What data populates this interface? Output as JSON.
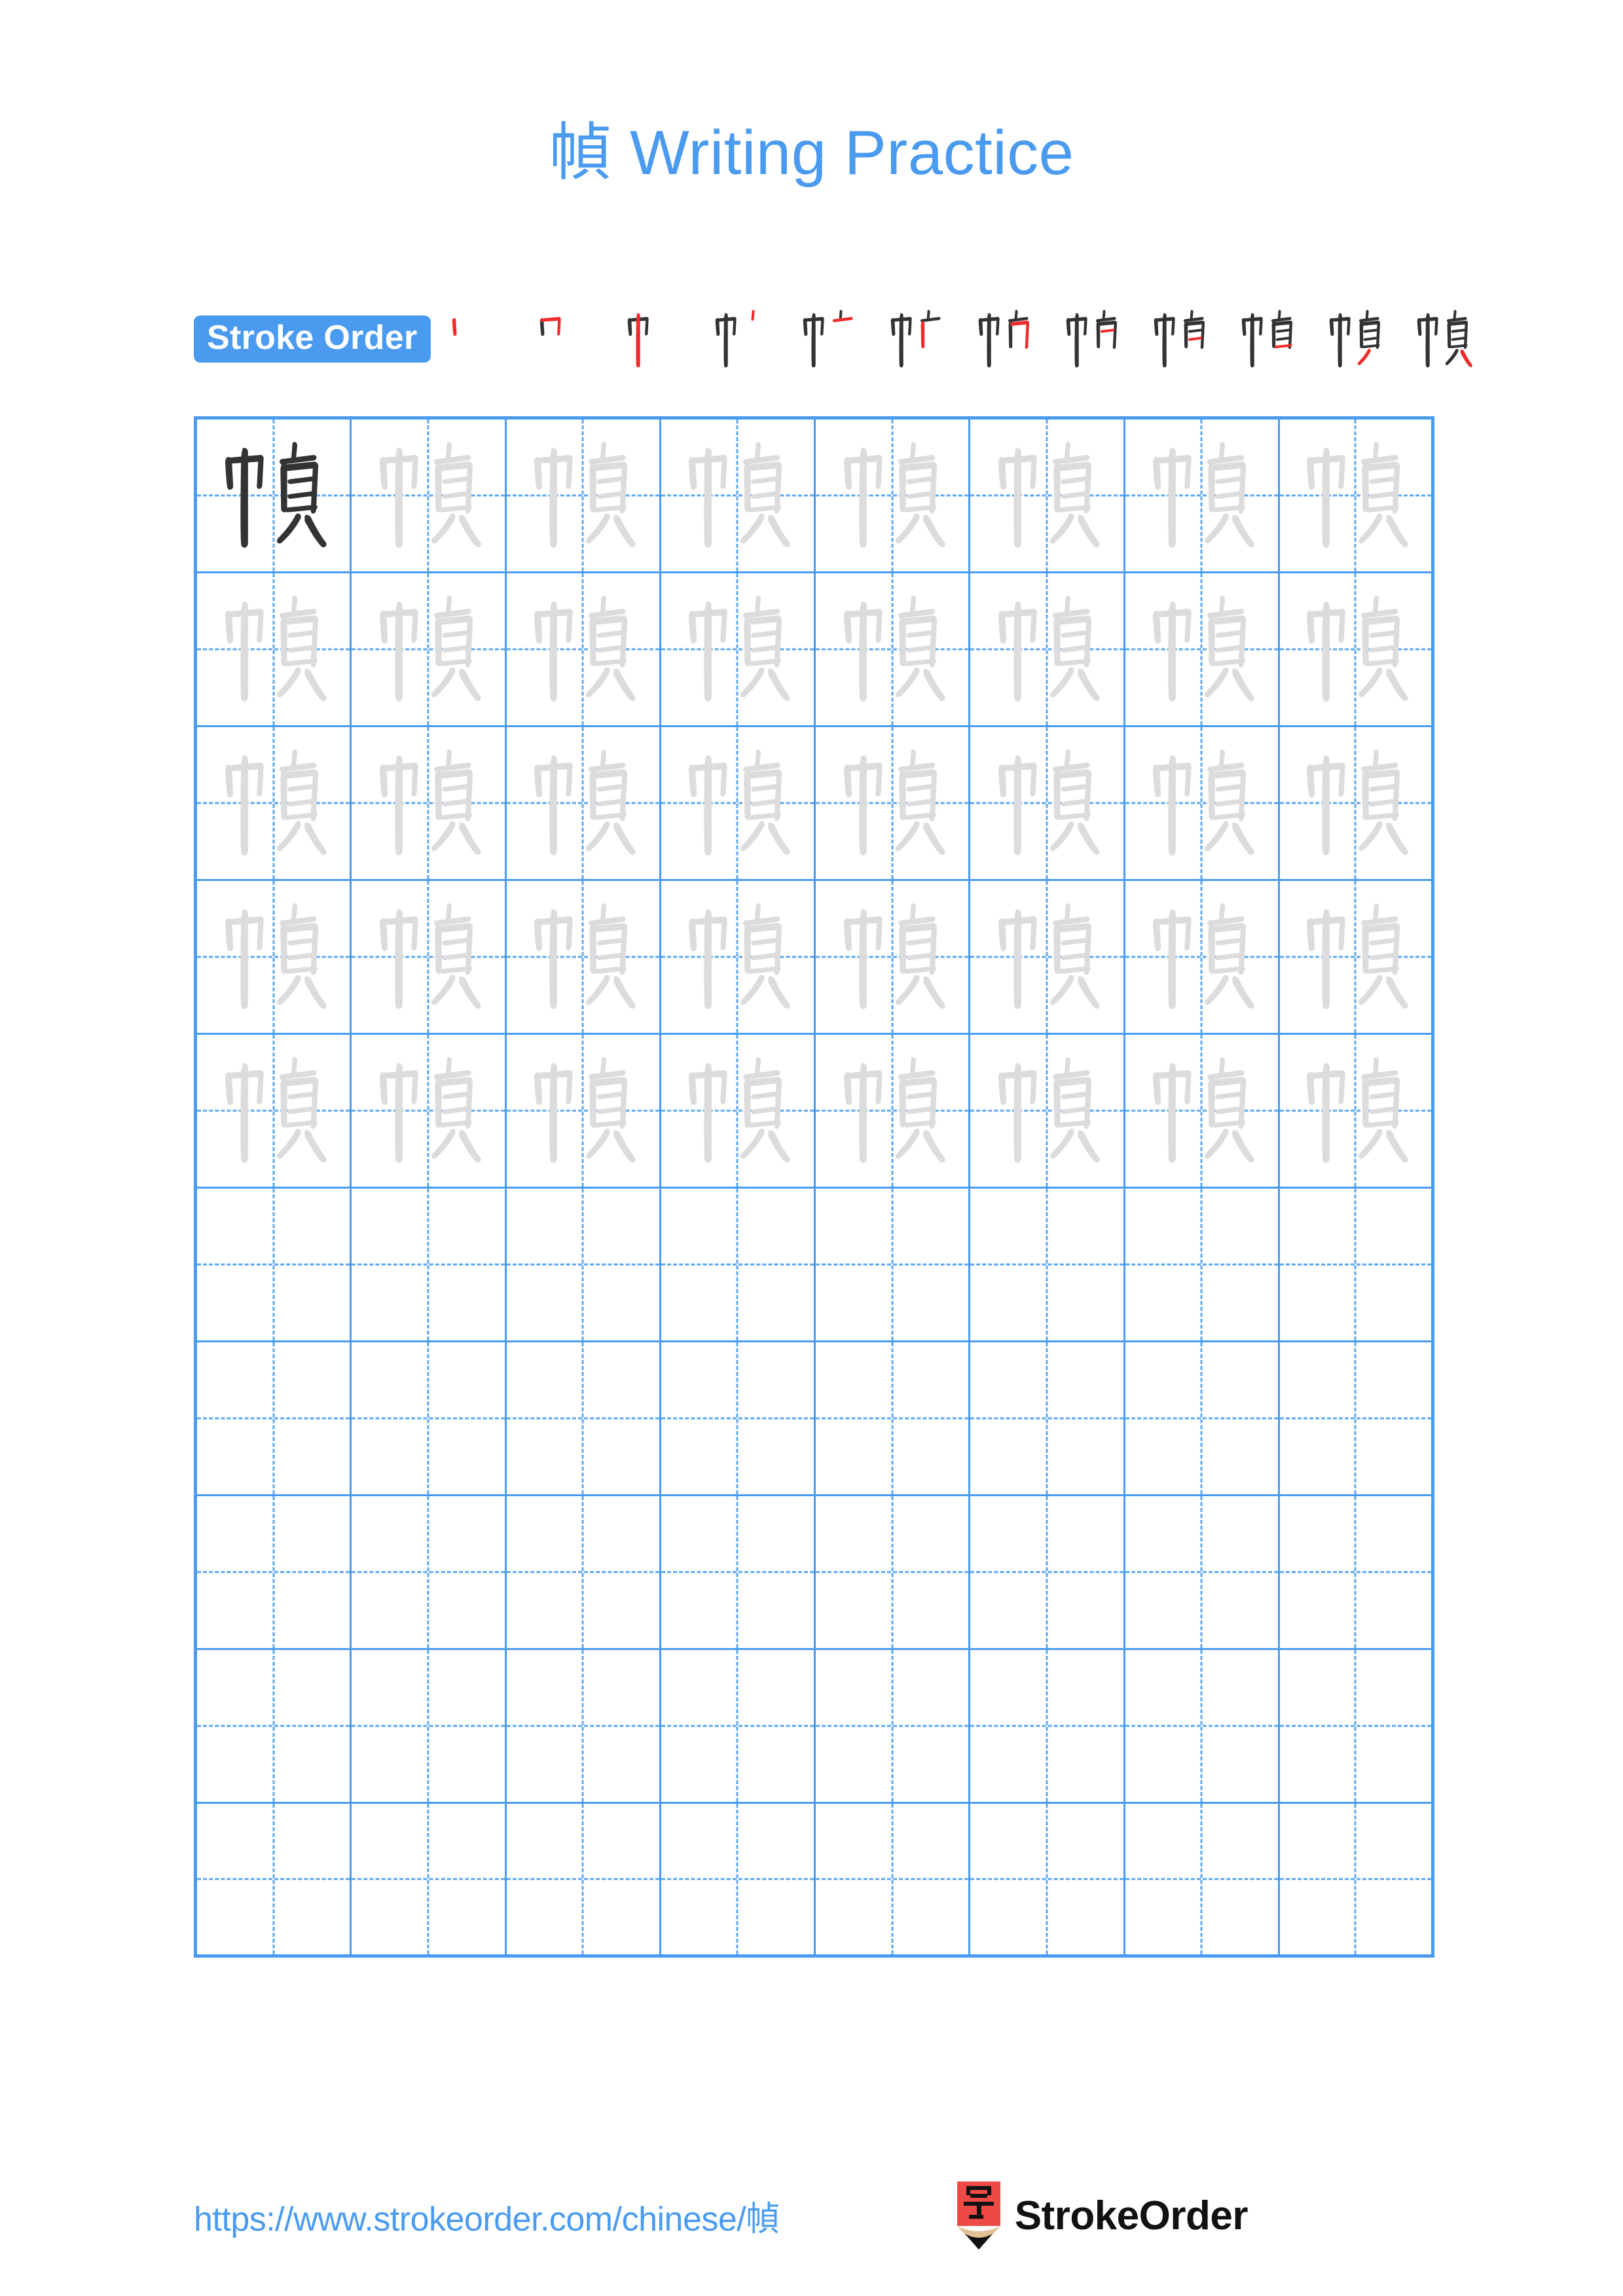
{
  "page": {
    "character": "幀",
    "title": "幀 Writing Practice",
    "title_character": "幀",
    "title_text": " Writing Practice",
    "accent_color": "#4a9bf0",
    "highlight_stroke_color": "#ef2b2b",
    "ink_color": "#333333",
    "trace_color": "#dcdcdc"
  },
  "stroke_order": {
    "label": "Stroke Order",
    "total_strokes": 12,
    "steps": [
      {
        "index": 1,
        "strokes_shown": 1,
        "new_stroke": 1
      },
      {
        "index": 2,
        "strokes_shown": 2,
        "new_stroke": 2
      },
      {
        "index": 3,
        "strokes_shown": 3,
        "new_stroke": 3
      },
      {
        "index": 4,
        "strokes_shown": 4,
        "new_stroke": 4
      },
      {
        "index": 5,
        "strokes_shown": 5,
        "new_stroke": 5
      },
      {
        "index": 6,
        "strokes_shown": 6,
        "new_stroke": 6
      },
      {
        "index": 7,
        "strokes_shown": 7,
        "new_stroke": 7
      },
      {
        "index": 8,
        "strokes_shown": 8,
        "new_stroke": 8
      },
      {
        "index": 9,
        "strokes_shown": 9,
        "new_stroke": 9
      },
      {
        "index": 10,
        "strokes_shown": 10,
        "new_stroke": 10
      },
      {
        "index": 11,
        "strokes_shown": 11,
        "new_stroke": 11
      },
      {
        "index": 12,
        "strokes_shown": 12,
        "new_stroke": 12
      }
    ]
  },
  "practice_grid": {
    "columns": 8,
    "rows": 10,
    "rows_data": [
      {
        "row": 1,
        "cells": [
          "dark",
          "light",
          "light",
          "light",
          "light",
          "light",
          "light",
          "light"
        ]
      },
      {
        "row": 2,
        "cells": [
          "light",
          "light",
          "light",
          "light",
          "light",
          "light",
          "light",
          "light"
        ]
      },
      {
        "row": 3,
        "cells": [
          "light",
          "light",
          "light",
          "light",
          "light",
          "light",
          "light",
          "light"
        ]
      },
      {
        "row": 4,
        "cells": [
          "light",
          "light",
          "light",
          "light",
          "light",
          "light",
          "light",
          "light"
        ]
      },
      {
        "row": 5,
        "cells": [
          "light",
          "light",
          "light",
          "light",
          "light",
          "light",
          "light",
          "light"
        ]
      },
      {
        "row": 6,
        "cells": [
          "empty",
          "empty",
          "empty",
          "empty",
          "empty",
          "empty",
          "empty",
          "empty"
        ]
      },
      {
        "row": 7,
        "cells": [
          "empty",
          "empty",
          "empty",
          "empty",
          "empty",
          "empty",
          "empty",
          "empty"
        ]
      },
      {
        "row": 8,
        "cells": [
          "empty",
          "empty",
          "empty",
          "empty",
          "empty",
          "empty",
          "empty",
          "empty"
        ]
      },
      {
        "row": 9,
        "cells": [
          "empty",
          "empty",
          "empty",
          "empty",
          "empty",
          "empty",
          "empty",
          "empty"
        ]
      },
      {
        "row": 10,
        "cells": [
          "empty",
          "empty",
          "empty",
          "empty",
          "empty",
          "empty",
          "empty",
          "empty"
        ]
      }
    ]
  },
  "footer": {
    "url": "https://www.strokeorder.com/chinese/幀",
    "brand_name": "StrokeOrder",
    "brand_mark_character": "字",
    "brand_mark_body_color": "#ee4a45",
    "brand_mark_wood_color": "#e3bf95",
    "brand_mark_tip_color": "#111111"
  }
}
